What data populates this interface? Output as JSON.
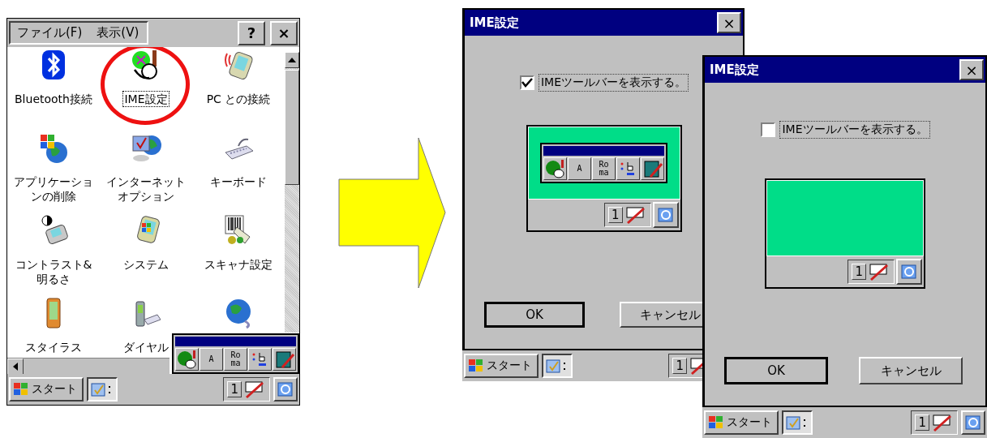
{
  "control_panel": {
    "menu": [
      {
        "label": "ファイル(F)"
      },
      {
        "label": "表示(V)"
      }
    ],
    "help_button": "?",
    "close_button": "×",
    "items": [
      {
        "label": "Bluetooth接続",
        "selected": false,
        "circled": false
      },
      {
        "label": "IME設定",
        "selected": true,
        "circled": true
      },
      {
        "label": "PC との接続",
        "selected": false,
        "circled": false
      },
      {
        "label": "アプリケーションの削除",
        "selected": false,
        "circled": false
      },
      {
        "label": "インターネットオプション",
        "selected": false,
        "circled": false
      },
      {
        "label": "キーボード",
        "selected": false,
        "circled": false
      },
      {
        "label": "コントラスト&明るさ",
        "selected": false,
        "circled": false
      },
      {
        "label": "システム",
        "selected": false,
        "circled": false
      },
      {
        "label": "スキャナ設定",
        "selected": false,
        "circled": false
      },
      {
        "label": "スタイラス",
        "selected": false,
        "circled": false
      },
      {
        "label": "ダイヤル",
        "selected": false,
        "circled": false
      },
      {
        "circled": false
      }
    ],
    "ime_toolbar": {
      "buttons": [
        {
          "kind": "icon"
        },
        {
          "kind": "text",
          "lines": [
            "A"
          ]
        },
        {
          "kind": "text",
          "lines": [
            "Ro",
            "ma"
          ]
        },
        {
          "kind": "icon"
        },
        {
          "kind": "icon"
        }
      ]
    },
    "taskbar": {
      "start": "スタート",
      "tray_number": "1"
    }
  },
  "dialogs": [
    {
      "title": "IME設定",
      "close_button": "×",
      "checkbox": {
        "label": "IMEツールバーを表示する。",
        "checked": true,
        "focused": true
      },
      "preview": {
        "toolbar": {
          "buttons": [
            {
              "kind": "icon"
            },
            {
              "kind": "text",
              "lines": [
                "A"
              ]
            },
            {
              "kind": "text",
              "lines": [
                "Ro",
                "ma"
              ]
            },
            {
              "kind": "icon"
            },
            {
              "kind": "icon"
            }
          ]
        },
        "tray_number": "1"
      },
      "buttons": [
        {
          "label": "OK",
          "default": true
        },
        {
          "label": "キャンセル",
          "default": false
        }
      ],
      "taskbar": {
        "start": "スタート",
        "tray_number": "1"
      }
    },
    {
      "title": "IME設定",
      "close_button": "×",
      "checkbox": {
        "label": "IMEツールバーを表示する。",
        "checked": false,
        "focused": true
      },
      "preview": {
        "tray_number": "1"
      },
      "buttons": [
        {
          "label": "OK",
          "default": true
        },
        {
          "label": "キャンセル",
          "default": false
        }
      ],
      "taskbar": {
        "start": "スタート",
        "tray_number": "1"
      }
    }
  ]
}
